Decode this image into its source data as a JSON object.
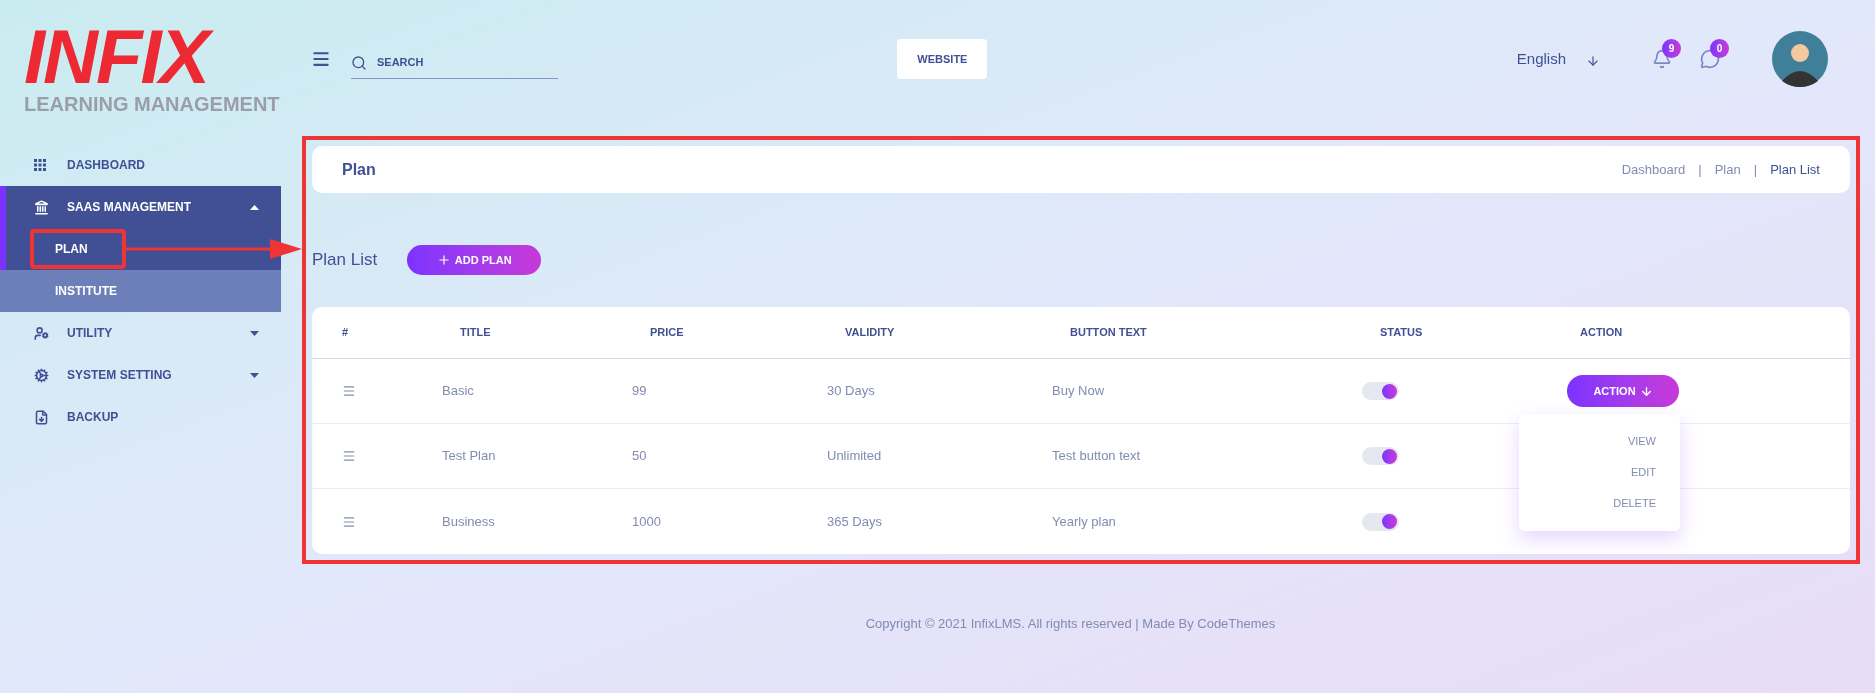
{
  "logo": {
    "wordmark": "INFIX",
    "tagline": "LEARNING MANAGEMENT"
  },
  "sidebar": {
    "items": [
      {
        "label": "DASHBOARD",
        "kind": "link",
        "selected": false
      },
      {
        "label": "SAAS MANAGEMENT",
        "kind": "group",
        "selected": true,
        "expanded": true,
        "children": [
          {
            "label": "PLAN",
            "selected": true
          },
          {
            "label": "INSTITUTE",
            "selected": false
          }
        ]
      },
      {
        "label": "UTILITY",
        "kind": "group",
        "selected": false,
        "expanded": false
      },
      {
        "label": "SYSTEM SETTING",
        "kind": "group",
        "selected": false,
        "expanded": false
      },
      {
        "label": "BACKUP",
        "kind": "link",
        "selected": false
      }
    ]
  },
  "topbar": {
    "search": {
      "placeholder": "SEARCH"
    },
    "website_button": "WEBSITE",
    "language": "English",
    "notifications": "9",
    "messages": "0"
  },
  "page_header": {
    "title": "Plan",
    "separator": "|",
    "breadcrumb": [
      {
        "label": "Dashboard",
        "current": false
      },
      {
        "label": "Plan",
        "current": false
      },
      {
        "label": "Plan List",
        "current": true
      }
    ]
  },
  "section": {
    "title": "Plan List",
    "add_button": "ADD PLAN"
  },
  "table": {
    "columns": [
      "#",
      "TITLE",
      "PRICE",
      "VALIDITY",
      "BUTTON TEXT",
      "STATUS",
      "ACTION"
    ],
    "rows": [
      {
        "title": "Basic",
        "price": "99",
        "validity": "30 Days",
        "button_text": "Buy Now",
        "status_on": true,
        "action": "ACTION"
      },
      {
        "title": "Test Plan",
        "price": "50",
        "validity": "Unlimited",
        "button_text": "Test button text",
        "status_on": true
      },
      {
        "title": "Business",
        "price": "1000",
        "validity": "365 Days",
        "button_text": "Yearly plan",
        "status_on": true
      }
    ]
  },
  "action_menu": {
    "items": [
      "VIEW",
      "EDIT",
      "DELETE"
    ]
  },
  "footer": "Copyright © 2021 InfixLMS. All rights reserved | Made By CodeThemes"
}
